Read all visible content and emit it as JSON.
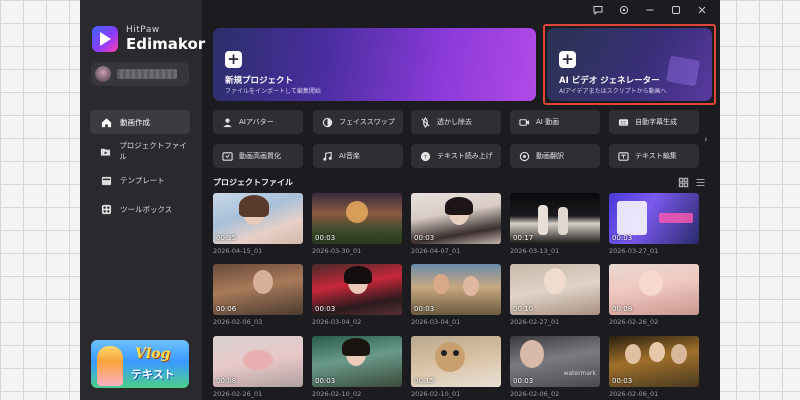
{
  "app": {
    "brand_sub": "HitPaw",
    "brand_main": "Edimakor"
  },
  "sidebar": {
    "items": [
      {
        "label": "動画作成",
        "icon": "home-icon",
        "active": true
      },
      {
        "label": "プロジェクトファイル",
        "icon": "folder-icon",
        "active": false
      },
      {
        "label": "テンプレート",
        "icon": "template-icon",
        "active": false
      },
      {
        "label": "ツールボックス",
        "icon": "toolbox-icon",
        "active": false
      }
    ],
    "banner": {
      "title": "Vlog",
      "subtitle": "テキスト"
    }
  },
  "hero": {
    "new_project": {
      "title": "新規プロジェクト",
      "subtitle": "ファイルをインポートして編集開始"
    },
    "ai_video": {
      "title": "AI ビデオ ジェネレーター",
      "subtitle": "AIアイデアまたはスクリプトから動画へ"
    }
  },
  "tools": [
    {
      "label": "AIアバター",
      "icon": "avatar-icon"
    },
    {
      "label": "フェイススワップ",
      "icon": "face-swap-icon"
    },
    {
      "label": "透かし除去",
      "icon": "watermark-remove-icon"
    },
    {
      "label": "AI 動画",
      "icon": "ai-video-icon"
    },
    {
      "label": "自動字幕生成",
      "icon": "subtitle-icon"
    },
    {
      "label": "動画高画質化",
      "icon": "enhance-icon"
    },
    {
      "label": "AI音楽",
      "icon": "music-icon"
    },
    {
      "label": "テキスト読み上げ",
      "icon": "tts-icon"
    },
    {
      "label": "動画翻訳",
      "icon": "translate-icon"
    },
    {
      "label": "テキスト編集",
      "icon": "text-edit-icon"
    }
  ],
  "projects": {
    "title": "プロジェクトファイル",
    "items": [
      {
        "duration": "00:35",
        "name": "2026-04-15_01"
      },
      {
        "duration": "00:03",
        "name": "2026-03-30_01"
      },
      {
        "duration": "00:03",
        "name": "2026-04-07_01"
      },
      {
        "duration": "00:17",
        "name": "2026-03-13_01"
      },
      {
        "duration": "00:03",
        "name": "2026-03-27_01"
      },
      {
        "duration": "00:06",
        "name": "2026-02-06_03"
      },
      {
        "duration": "00:03",
        "name": "2026-03-04_02"
      },
      {
        "duration": "00:03",
        "name": "2026-03-04_01"
      },
      {
        "duration": "00:10",
        "name": "2026-02-27_01"
      },
      {
        "duration": "00:08",
        "name": "2026-02-26_02"
      },
      {
        "duration": "00:08",
        "name": "2026-02-26_01"
      },
      {
        "duration": "00:03",
        "name": "2026-02-10_02"
      },
      {
        "duration": "00:15",
        "name": "2026-02-10_01"
      },
      {
        "duration": "00:03",
        "name": "2026-02-06_02"
      },
      {
        "duration": "00:03",
        "name": "2026-02-06_01"
      }
    ]
  },
  "colors": {
    "app_bg": "#1c1c20",
    "sidebar_bg": "#2a2a2e",
    "highlight": "#e0453a"
  }
}
